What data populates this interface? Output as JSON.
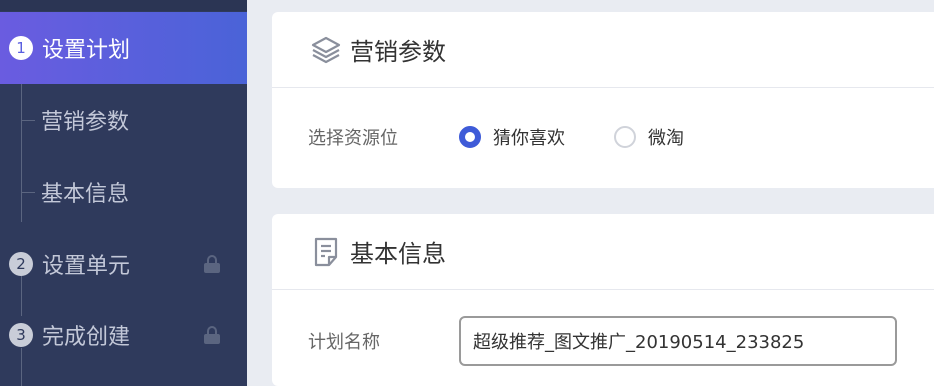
{
  "sidebar": {
    "steps": [
      {
        "num": "1",
        "label": "设置计划",
        "active": true
      },
      {
        "num": "2",
        "label": "设置单元",
        "locked": true
      },
      {
        "num": "3",
        "label": "完成创建",
        "locked": true
      }
    ],
    "substeps": [
      {
        "label": "营销参数"
      },
      {
        "label": "基本信息"
      }
    ]
  },
  "marketing_params": {
    "title": "营销参数",
    "icon": "layers-icon",
    "field_label": "选择资源位",
    "options": [
      {
        "label": "猜你喜欢",
        "checked": true
      },
      {
        "label": "微淘",
        "checked": false
      }
    ]
  },
  "basic_info": {
    "title": "基本信息",
    "icon": "document-icon",
    "field_label": "计划名称",
    "plan_name_value": "超级推荐_图文推广_20190514_233825"
  },
  "colors": {
    "sidebar_bg": "#2f3a5c",
    "active_gradient_start": "#6a5ce0",
    "active_gradient_end": "#4a63d8",
    "radio_checked": "#3e5bd8"
  }
}
